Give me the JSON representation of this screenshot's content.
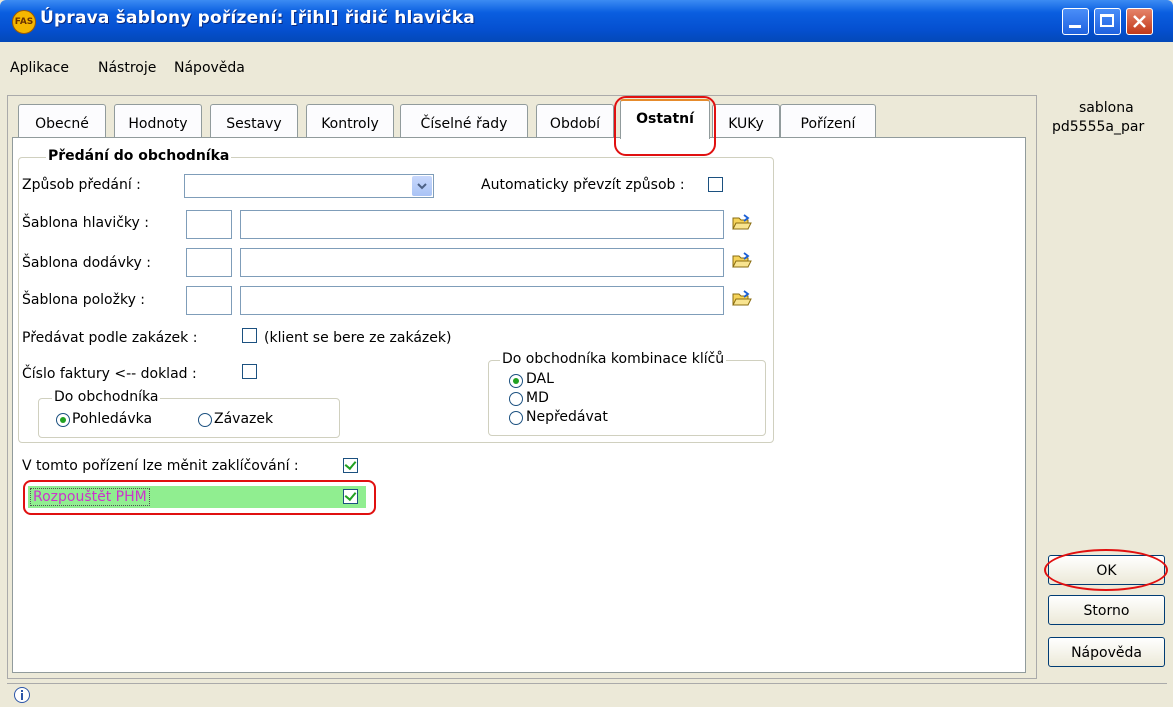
{
  "window": {
    "logo": "FAS",
    "title": "Úprava šablony pořízení: [řihl] řidič hlavička"
  },
  "menu": [
    "Aplikace",
    "Nástroje",
    "Nápověda"
  ],
  "tabs": [
    "Obecné",
    "Hodnoty",
    "Sestavy",
    "Kontroly",
    "Číselné řady",
    "Období",
    "Ostatní",
    "KUKy",
    "Pořízení"
  ],
  "active_tab": "Ostatní",
  "group_predani": {
    "title": "Předání do obchodníka",
    "zpusob_label": "Způsob předání :",
    "zpusob_value": "",
    "auto_label": "Automaticky převzít způsob :",
    "sablona_hlavicky_label": "Šablona hlavičky :",
    "sablona_dodavky_label": "Šablona dodávky :",
    "sablona_polozky_label": "Šablona položky :",
    "podle_zakazek_label": "Předávat podle zakázek :",
    "podle_zakazek_note": "(klient se bere ze zakázek)",
    "cislo_faktury_label": "Číslo faktury <-- doklad :"
  },
  "group_do_obchodnika": {
    "title": "Do obchodníka",
    "options": [
      "Pohledávka",
      "Závazek"
    ],
    "selected": "Pohledávka"
  },
  "group_kombinace": {
    "title": "Do obchodníka kombinace klíčů",
    "options": [
      "DAL",
      "MD",
      "Nepředávat"
    ],
    "selected": "DAL"
  },
  "zaklicovani_label": "V tomto pořízení lze měnit zaklíčování :",
  "zaklicovani_checked": true,
  "rozpoustet_label": "Rozpouštět PHM",
  "rozpoustet_checked": true,
  "sidebar": {
    "line1": "sablona",
    "line2": "pd5555a_par"
  },
  "buttons": {
    "ok": "OK",
    "storno": "Storno",
    "napoveda": "Nápověda"
  },
  "colors": {
    "highlight_green": "#90ee90",
    "highlight_text": "#cc33cc",
    "annotation_red": "#e01010"
  }
}
